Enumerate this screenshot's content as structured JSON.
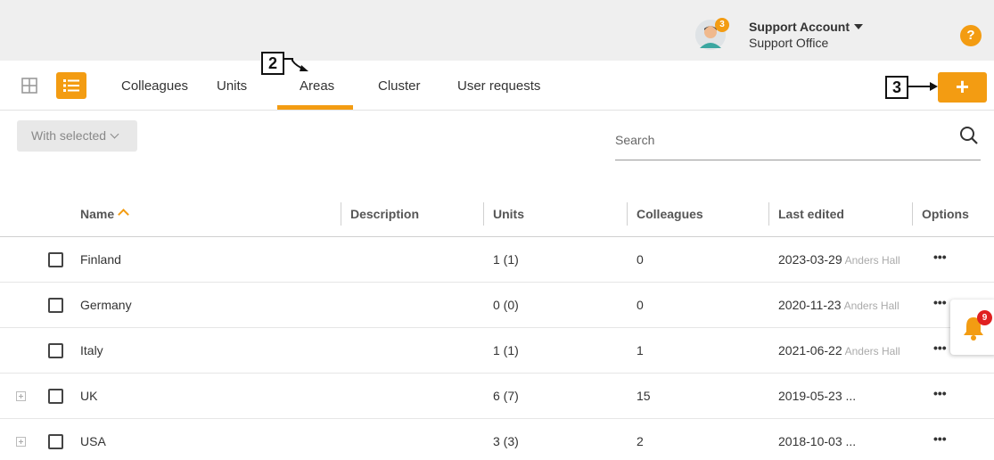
{
  "header": {
    "account_name": "Support Account",
    "account_office": "Support Office",
    "avatar_badge": "3",
    "help_label": "?"
  },
  "nav": {
    "tabs": [
      {
        "label": "Colleagues"
      },
      {
        "label": "Units"
      },
      {
        "label": "Areas",
        "active": true
      },
      {
        "label": "Cluster"
      },
      {
        "label": "User requests"
      }
    ],
    "add_label": "+"
  },
  "callouts": [
    "2",
    "3"
  ],
  "toolbar": {
    "with_selected": "With selected",
    "search_placeholder": "Search"
  },
  "table": {
    "columns": [
      "Name",
      "Description",
      "Units",
      "Colleagues",
      "Last edited",
      "Options"
    ],
    "rows": [
      {
        "name": "Finland",
        "units": "1 (1)",
        "colleagues": "0",
        "date": "2023-03-29",
        "editor": "Anders Hall",
        "expandable": false
      },
      {
        "name": "Germany",
        "units": "0 (0)",
        "colleagues": "0",
        "date": "2020-11-23",
        "editor": "Anders Hall",
        "expandable": false
      },
      {
        "name": "Italy",
        "units": "1 (1)",
        "colleagues": "1",
        "date": "2021-06-22",
        "editor": "Anders Hall",
        "expandable": false
      },
      {
        "name": "UK",
        "units": "6 (7)",
        "colleagues": "15",
        "date": "2019-05-23 ...",
        "editor": "",
        "expandable": true
      },
      {
        "name": "USA",
        "units": "3 (3)",
        "colleagues": "2",
        "date": "2018-10-03 ...",
        "editor": "",
        "expandable": true
      }
    ],
    "options_label": "•••"
  },
  "notifications": {
    "count": "9"
  },
  "colors": {
    "accent": "#f39c12",
    "badge_red": "#e02020",
    "topbar": "#efefef"
  }
}
